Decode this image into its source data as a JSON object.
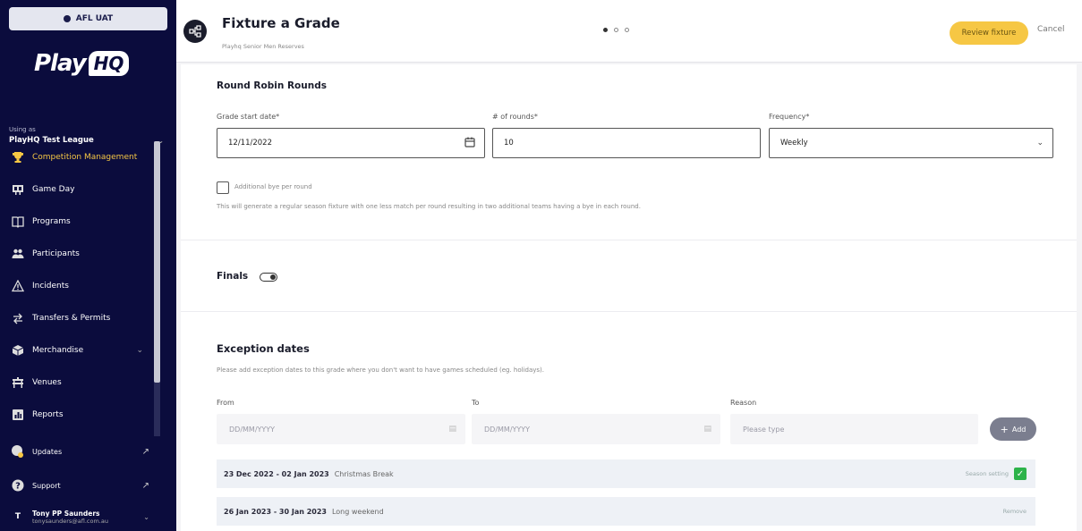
{
  "sidebar": {
    "env_label": "AFL UAT",
    "logo_text": "Play",
    "logo_hq": "HQ",
    "using_as": "Using as",
    "league": "PlayHQ Test League",
    "nav": [
      {
        "label": "Competition Management",
        "icon": "trophy-icon",
        "active": true
      },
      {
        "label": "Game Day",
        "icon": "scoreboard-icon"
      },
      {
        "label": "Programs",
        "icon": "book-icon"
      },
      {
        "label": "Participants",
        "icon": "people-icon"
      },
      {
        "label": "Incidents",
        "icon": "warning-icon"
      },
      {
        "label": "Transfers & Permits",
        "icon": "transfer-icon"
      },
      {
        "label": "Merchandise",
        "icon": "box-icon"
      },
      {
        "label": "Venues",
        "icon": "stadium-icon"
      },
      {
        "label": "Reports",
        "icon": "report-icon"
      }
    ],
    "bottom": [
      {
        "label": "Updates",
        "icon": "megaphone-icon"
      },
      {
        "label": "Support",
        "icon": "help-icon"
      }
    ],
    "user": {
      "initial": "T",
      "name": "Tony PP Saunders",
      "email": "tonysaunders@afl.com.au"
    }
  },
  "header": {
    "title": "Fixture a Grade",
    "subtitle": "Playhq Senior Men Reserves",
    "review_label": "Review fixture",
    "cancel_label": "Cancel"
  },
  "round_robin": {
    "title": "Round Robin Rounds",
    "start_label": "Grade start date*",
    "start_value": "12/11/2022",
    "rounds_label": "# of rounds*",
    "rounds_value": "10",
    "frequency_label": "Frequency*",
    "frequency_value": "Weekly",
    "bye_label": "Additional bye per round",
    "bye_help": "This will generate a regular season fixture with one less match per round resulting in two additional teams having a bye in each round."
  },
  "finals": {
    "label": "Finals"
  },
  "exceptions": {
    "title": "Exception dates",
    "help": "Please add exception dates to this grade where you don't want to have games scheduled (eg. holidays).",
    "from_label": "From",
    "to_label": "To",
    "reason_label": "Reason",
    "from_placeholder": "DD/MM/YYYY",
    "to_placeholder": "DD/MM/YYYY",
    "reason_placeholder": "Please type",
    "add_label": "Add",
    "rows": [
      {
        "dates": "23 Dec 2022 - 02 Jan 2023",
        "reason": "Christmas Break",
        "right": "Season setting"
      },
      {
        "dates": "26 Jan 2023 - 30 Jan 2023",
        "reason": "Long weekend",
        "right": "Remove"
      }
    ]
  },
  "colors": {
    "sidebar": "#0b0c3d",
    "accent": "#f6c744",
    "check": "#2db34a"
  }
}
